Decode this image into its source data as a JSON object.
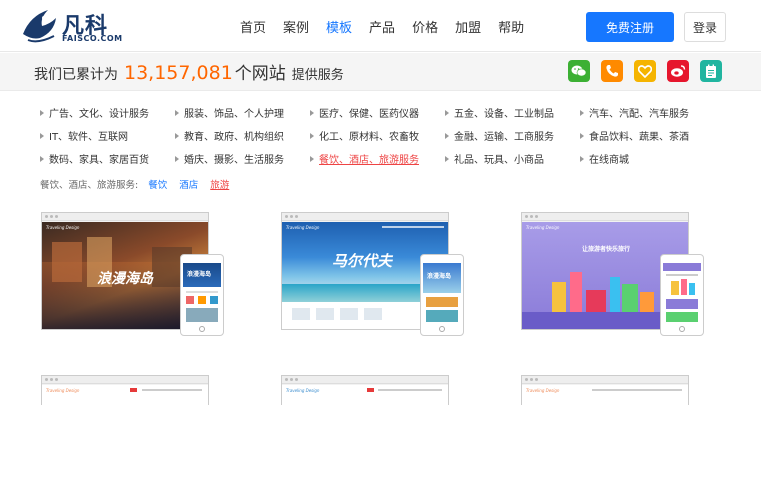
{
  "header": {
    "logo_cn": "凡科",
    "logo_en": "FAISCO.COM",
    "nav": [
      "首页",
      "案例",
      "模板",
      "产品",
      "价格",
      "加盟",
      "帮助"
    ],
    "nav_active_index": 2,
    "register_label": "免费注册",
    "login_label": "登录"
  },
  "stats": {
    "prefix": "我们已累计为",
    "number": "13,157,081",
    "suffix": "个网站",
    "post": "提供服务"
  },
  "social": [
    {
      "name": "wechat-icon",
      "color": "#3cb034"
    },
    {
      "name": "phone-icon",
      "color": "#ff8a00"
    },
    {
      "name": "heart-icon",
      "color": "#f5b400"
    },
    {
      "name": "weibo-icon",
      "color": "#e6162d"
    },
    {
      "name": "note-icon",
      "color": "#21b5a0"
    }
  ],
  "categories": [
    [
      "广告、文化、设计服务",
      "服装、饰品、个人护理",
      "医疗、保健、医药仪器",
      "五金、设备、工业制品",
      "汽车、汽配、汽车服务"
    ],
    [
      "IT、软件、互联网",
      "教育、政府、机构组织",
      "化工、原材料、农畜牧",
      "金融、运输、工商服务",
      "食品饮料、蔬果、茶酒"
    ],
    [
      "数码、家具、家居百货",
      "婚庆、摄影、生活服务",
      "餐饮、酒店、旅游服务",
      "礼品、玩具、小商品",
      "在线商城"
    ]
  ],
  "category_active": "餐饮、酒店、旅游服务",
  "subfilter": {
    "label": "餐饮、酒店、旅游服务:",
    "items": [
      "餐饮",
      "酒店",
      "旅游"
    ],
    "active": "旅游"
  },
  "templates": [
    {
      "brand": "Traveling Design",
      "headline": "浪漫海岛",
      "phone_headline": "浪漫海岛"
    },
    {
      "brand": "Traveling Design",
      "headline": "马尔代夫",
      "phone_headline": "浪漫海岛"
    },
    {
      "brand": "Traveling Design",
      "headline": "让旅游者快乐旅行",
      "phone_headline": ""
    }
  ],
  "lower_templates": [
    {
      "brand": "Traveling Design"
    },
    {
      "brand": "Traveling Design"
    },
    {
      "brand": "Traveling Design"
    }
  ],
  "colors": {
    "accent": "#1677ff",
    "stat_number": "#ff6600",
    "category_active": "#ee4444"
  }
}
